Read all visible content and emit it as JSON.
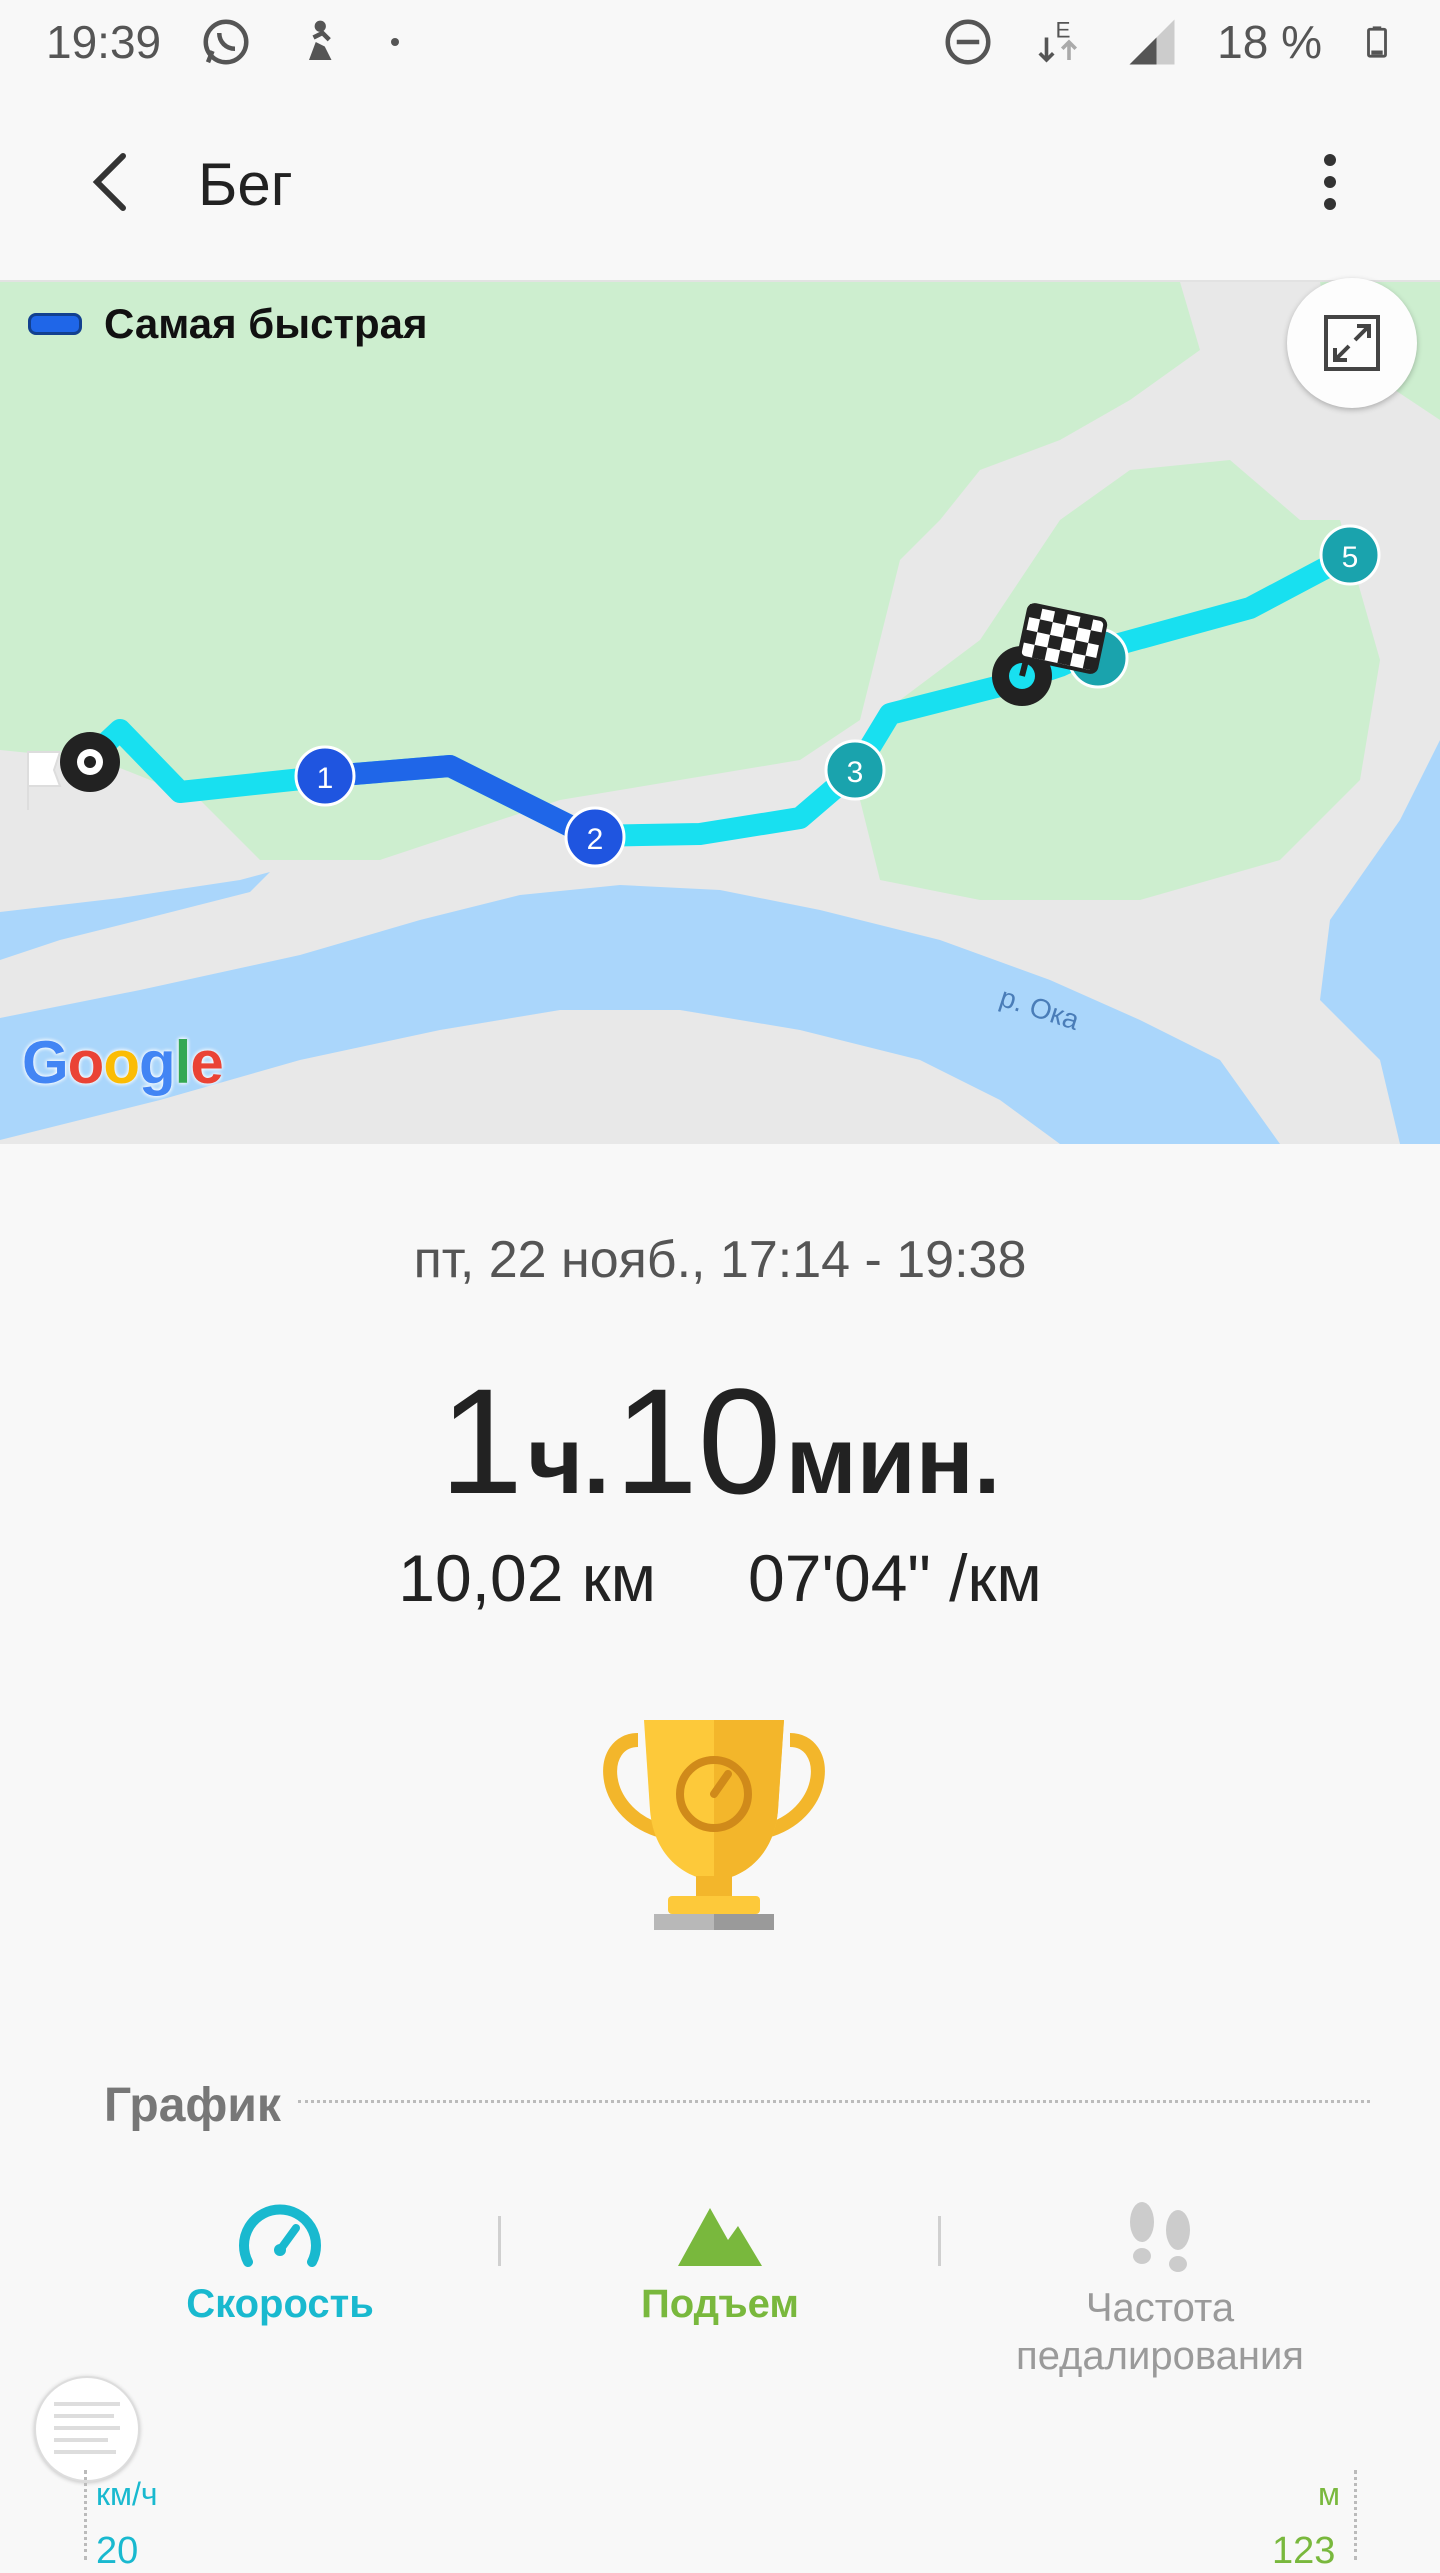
{
  "status_bar": {
    "time": "19:39",
    "battery": "18 %",
    "icons": [
      "whatsapp-icon",
      "activity-icon",
      "dot-icon",
      "dnd-icon",
      "data-e-icon",
      "signal-icon",
      "battery-icon"
    ]
  },
  "app_bar": {
    "title": "Бег",
    "back_icon": "back-arrow-icon",
    "menu_icon": "more-vert-icon"
  },
  "map": {
    "legend_label": "Самая быстрая",
    "river_label": "р. Ока",
    "logo_text": "Google",
    "markers": [
      "1",
      "2",
      "3",
      "5"
    ],
    "colors": {
      "land": "#e8e8e8",
      "park": "#cdeecf",
      "water": "#aad6fb",
      "route_fast": "#1f66e8",
      "route": "#18e0f0",
      "marker_teal": "#1aa3ad"
    }
  },
  "summary": {
    "date_range": "пт, 22 нояб., 17:14 - 19:38",
    "duration_hours": "1",
    "duration_hours_unit": "ч.",
    "duration_minutes": "10",
    "duration_minutes_unit": "мин.",
    "distance": "10,02 км",
    "pace": "07'04\" /км"
  },
  "chart_section": {
    "title": "График",
    "tabs": [
      {
        "label": "Скорость",
        "icon": "speedometer-icon"
      },
      {
        "label": "Подъем",
        "icon": "mountain-icon"
      },
      {
        "label_line1": "Частота",
        "label_line2": "педалирования",
        "icon": "footsteps-icon"
      }
    ],
    "left_axis_unit": "км/ч",
    "left_axis_top": "20",
    "right_axis_unit": "м",
    "right_axis_top": "123"
  }
}
